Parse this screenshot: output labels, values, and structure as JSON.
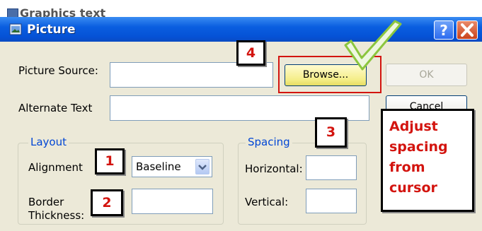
{
  "background_window": {
    "title": "Graphics text"
  },
  "dialog": {
    "title": "Picture",
    "help_label": "?",
    "picture_source": {
      "label": "Picture Source:",
      "value": ""
    },
    "browse_label": "Browse...",
    "ok_label": "OK",
    "alternate_text": {
      "label": "Alternate Text",
      "value": ""
    },
    "cancel_label": "Cancel",
    "layout": {
      "legend": "Layout",
      "alignment_label": "Alignment",
      "alignment_value": "Baseline",
      "border_label_line1": "Border",
      "border_label_line2": "Thickness:",
      "border_value": ""
    },
    "spacing": {
      "legend": "Spacing",
      "horizontal_label": "Horizontal:",
      "horizontal_value": "",
      "vertical_label": "Vertical:",
      "vertical_value": ""
    }
  },
  "annotations": {
    "step1": "1",
    "step2": "2",
    "step3": "3",
    "step4": "4",
    "note_lines": [
      "Adjust",
      "spacing",
      "from",
      "cursor"
    ],
    "highlight_color": "#d3140f",
    "check_color": "#8cc63e"
  },
  "colors": {
    "titlebar": "#0552d6",
    "dialog_bg": "#ece9d8",
    "group_legend": "#0046d5"
  },
  "icons": [
    "window-icon",
    "help-icon",
    "close-icon",
    "dropdown-arrow-icon",
    "checkmark-icon"
  ]
}
